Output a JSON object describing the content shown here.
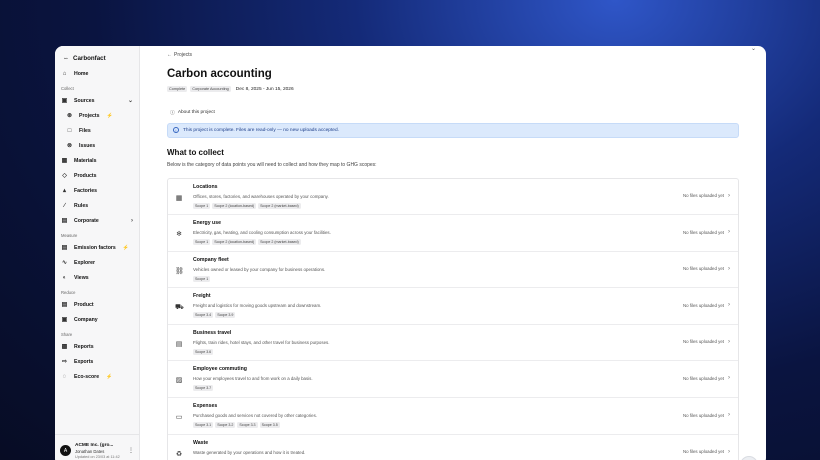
{
  "brand": {
    "name": "Carbonfact",
    "logo_icon": "carbonfact-logo-icon"
  },
  "sidebar": {
    "home": {
      "label": "Home",
      "icon": "home-icon"
    },
    "sections": [
      {
        "label": "Collect"
      },
      {
        "label": "Measure"
      },
      {
        "label": "Reduce"
      },
      {
        "label": "Share"
      }
    ],
    "collect_items": [
      {
        "label": "Sources",
        "icon": "sources-icon"
      },
      {
        "label": "Projects",
        "icon": "projects-icon"
      },
      {
        "label": "Files",
        "icon": "files-icon"
      },
      {
        "label": "Issues",
        "icon": "issues-icon"
      },
      {
        "label": "Materials",
        "icon": "materials-icon"
      },
      {
        "label": "Products",
        "icon": "products-icon"
      },
      {
        "label": "Factories",
        "icon": "factories-icon"
      },
      {
        "label": "Rules",
        "icon": "rules-icon"
      },
      {
        "label": "Corporate",
        "icon": "corporate-icon"
      }
    ],
    "measure_items": [
      {
        "label": "Emission factors",
        "icon": "emission-factors-icon"
      },
      {
        "label": "Explorer",
        "icon": "explorer-icon"
      },
      {
        "label": "Views",
        "icon": "views-icon"
      }
    ],
    "reduce_items": [
      {
        "label": "Product",
        "icon": "product-icon"
      },
      {
        "label": "Company",
        "icon": "company-icon"
      }
    ],
    "share_items": [
      {
        "label": "Reports",
        "icon": "reports-icon"
      },
      {
        "label": "Exports",
        "icon": "exports-icon"
      },
      {
        "label": "Eco-score",
        "icon": "eco-score-icon"
      }
    ],
    "account": {
      "avatar": "A",
      "name": "ACME Inc. (gro...",
      "user": "Jonathan Dates",
      "updated": "Updated on 23/03 at 11:42"
    }
  },
  "main": {
    "back_label": "Projects",
    "title": "Carbon accounting",
    "tags": [
      "Complete",
      "Corporate Accounting"
    ],
    "dates": "Dec 8, 2025 - Jun 15, 2026",
    "about_label": "About this project",
    "banner": "This project is complete. Files are read-only — no new uploads accepted.",
    "section_title": "What to collect",
    "section_desc": "Below is the category of data points you will need to collect and how they map to GHG scopes:",
    "status_text": "No files uploaded yet",
    "categories": [
      {
        "name": "Locations",
        "desc": "Offices, stores, factories, and warehouses operated by your company.",
        "tags": [
          "Scope 1",
          "Scope 2 (location-based)",
          "Scope 2 (market-based)"
        ],
        "icon": "building-icon"
      },
      {
        "name": "Energy use",
        "desc": "Electricity, gas, heating, and cooling consumption across your facilities.",
        "tags": [
          "Scope 1",
          "Scope 2 (location-based)",
          "Scope 2 (market-based)"
        ],
        "icon": "flame-icon"
      },
      {
        "name": "Company fleet",
        "desc": "Vehicles owned or leased by your company for business operations.",
        "tags": [
          "Scope 1"
        ],
        "icon": "car-icon"
      },
      {
        "name": "Freight",
        "desc": "Freight and logistics for moving goods upstream and downstream.",
        "tags": [
          "Scope 3.4",
          "Scope 3.9"
        ],
        "icon": "truck-icon"
      },
      {
        "name": "Business travel",
        "desc": "Flights, train rides, hotel stays, and other travel for business purposes.",
        "tags": [
          "Scope 3.6"
        ],
        "icon": "luggage-icon"
      },
      {
        "name": "Employee commuting",
        "desc": "How your employees travel to and from work on a daily basis.",
        "tags": [
          "Scope 3.7"
        ],
        "icon": "bus-icon"
      },
      {
        "name": "Expenses",
        "desc": "Purchased goods and services not covered by other categories.",
        "tags": [
          "Scope 3.1",
          "Scope 3.2",
          "Scope 3.3",
          "Scope 3.5"
        ],
        "icon": "credit-card-icon"
      },
      {
        "name": "Waste",
        "desc": "Waste generated by your operations and how it is treated.",
        "tags": [],
        "icon": "recycle-icon"
      }
    ]
  }
}
